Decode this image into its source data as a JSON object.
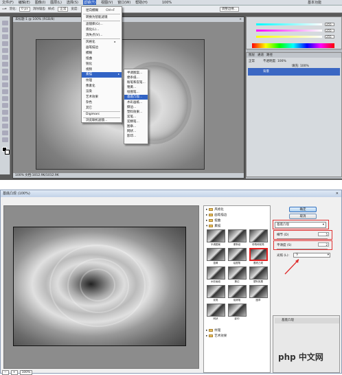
{
  "top": {
    "menubar": [
      "文件(F)",
      "编辑(E)",
      "图像(I)",
      "图层(L)",
      "选择(S)",
      "滤镜(T)",
      "视图(V)",
      "窗口(W)",
      "帮助(H)"
    ],
    "zoom": "100%",
    "workspace": "基本功能",
    "options": [
      "羽化:",
      "0 px",
      "消除锯齿",
      "样式:",
      "正常",
      "宽度:",
      "高度:",
      "调整边缘..."
    ],
    "doc_title": "未标题-1 @ 100% (RGB/8)",
    "doc_status": "100%   文档:1012.9K/1012.9K",
    "filter_menu": {
      "items": [
        "径向模糊",
        "转换为智能滤镜",
        "滤镜库(G)...",
        "液化(L)...",
        "消失点(V)...",
        "风格化",
        "画笔描边",
        "模糊",
        "扭曲",
        "锐化",
        "视频",
        "素描",
        "纹理",
        "像素化",
        "渲染",
        "艺术效果",
        "杂色",
        "其它",
        "Digimarc",
        "浏览联机滤镜..."
      ],
      "shortcut": "Ctrl+F",
      "highlighted": "素描"
    },
    "sketch_submenu": {
      "items": [
        "半调图案...",
        "便条纸...",
        "粉笔和炭笔...",
        "铬黄...",
        "绘图笔...",
        "基底凸现...",
        "水彩画纸...",
        "撕边...",
        "塑料效果...",
        "炭笔...",
        "炭精笔...",
        "图章...",
        "网状...",
        "影印..."
      ],
      "highlighted": "基底凸现..."
    },
    "color_panel": {
      "r": "255",
      "g": "255",
      "b": "255"
    },
    "layers_tabs": [
      "图层",
      "通道",
      "路径"
    ],
    "layer_mode": "正常",
    "opacity": "不透明度: 100%",
    "fill": "填充: 100%",
    "layer_name": "背景"
  },
  "dialog": {
    "title": "基底凸现 (100%)",
    "zoom": "100%",
    "categories_top": [
      "风格化",
      "画笔描边",
      "扭曲",
      "素描"
    ],
    "categories_bottom": [
      "纹理",
      "艺术效果"
    ],
    "thumbs": [
      "半调图案",
      "便条纸",
      "粉笔和炭笔",
      "铬黄",
      "绘图笔",
      "基底凸现",
      "水彩画纸",
      "撕边",
      "塑料效果",
      "炭笔",
      "炭精笔",
      "图章",
      "网状",
      "影印"
    ],
    "ok": "确定",
    "cancel": "取消",
    "filter_select": "基底凸现",
    "params": [
      {
        "label": "细节 (D)",
        "value": "5"
      },
      {
        "label": "平滑度 (S)",
        "value": "2"
      },
      {
        "label": "光照 (L):",
        "value": "下"
      }
    ],
    "layer_item": "基底凸现"
  },
  "watermark": "php 中文网"
}
